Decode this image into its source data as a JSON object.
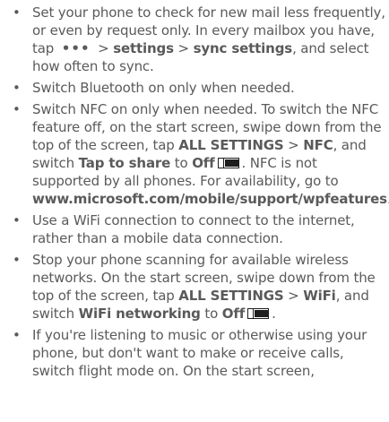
{
  "bullet_char": "•",
  "menu_dots": "•••",
  "tips": {
    "sync": {
      "t1": "Set your phone to check for new mail less frequently, or even by request only. In every mailbox you have, tap ",
      "t2": " > ",
      "b1": "settings",
      "t3": " > ",
      "b2": "sync settings",
      "t4": ", and select how often to sync."
    },
    "bluetooth": {
      "t1": "Switch Bluetooth on only when needed."
    },
    "nfc": {
      "t1": "Switch NFC on only when needed. To switch the NFC feature off, on the start screen, swipe down from the top of the screen, tap ",
      "b1": "ALL SETTINGS",
      "t2": " > ",
      "b2": "NFC",
      "t3": ", and switch ",
      "b3": "Tap to share",
      "t4": " to ",
      "b4": "Off",
      "t5": ". NFC is not supported by all phones. For availability, go to ",
      "link": "www.microsoft.com/mobile/support/wpfeatures",
      "t6": "."
    },
    "wifi_connection": {
      "t1": "Use a WiFi connection to connect to the internet, rather than a mobile data connection."
    },
    "scanning": {
      "t1": "Stop your phone scanning for available wireless networks. On the start screen, swipe down from the top of the screen, tap ",
      "b1": "ALL SETTINGS",
      "t2": " > ",
      "b2": "WiFi",
      "t3": ", and switch ",
      "b3": "WiFi networking",
      "t4": " to ",
      "b4": "Off",
      "t5": "."
    },
    "flight_mode": {
      "t1": "If you're listening to music or otherwise using your phone, but don't want to make or receive calls, switch flight mode on. On the start screen,"
    }
  },
  "icons": {
    "toggle_off": "toggle-off-icon",
    "more": "more-dots-icon"
  },
  "colors": {
    "text": "#5a5a5a",
    "icon": "#1e1e1e"
  }
}
